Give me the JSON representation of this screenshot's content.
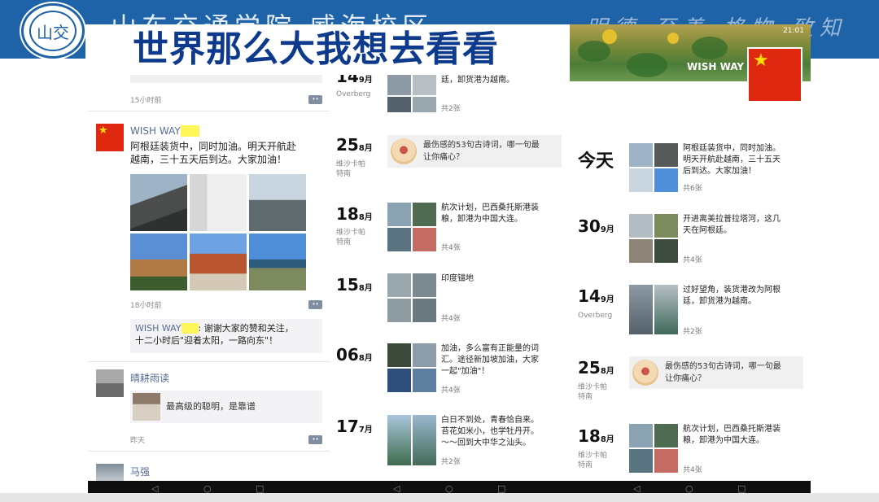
{
  "slide": {
    "title": "世界那么大我想去看看",
    "header_calligraphy_left": "山东交通学院 威海校区",
    "header_calligraphy_right": "明德 至善 格物 致知",
    "logo_text": "山交"
  },
  "colors": {
    "header_blue": "#1e63a8",
    "title_navy": "#0d3a8c",
    "link_blue": "#576b95",
    "flag_red": "#de2910"
  },
  "phone1": {
    "post0_time": "15小时前",
    "post1": {
      "user": "WISH WAY",
      "text_line1": "阿根廷装货中，同时加油。明天开航赴",
      "text_line2": "越南，三十五天后到达。大家加油！",
      "time": "18小时前",
      "comment_user": "WISH WAY",
      "comment_sep": ": ",
      "comment_line1": "谢谢大家的赞和关注，",
      "comment_line2": "十二小时后\"迎着太阳，一路向东\"！"
    },
    "post2": {
      "user": "晴耕雨读",
      "share_text": "最高级的聪明，是靠谱",
      "time": "昨天"
    },
    "post3": {
      "user": "马强"
    }
  },
  "phone2": {
    "entries": [
      {
        "day": "14",
        "month": "9月",
        "loc": "Overberg",
        "text": [
          "廷，卸货港为越南。"
        ],
        "count": "共2张"
      },
      {
        "day": "25",
        "month": "8月",
        "loc": "维沙卡帕\n特南",
        "share": [
          "最伤感的53句古诗词，哪一句最",
          "让你痛心？"
        ]
      },
      {
        "day": "18",
        "month": "8月",
        "loc": "维沙卡帕\n特南",
        "text": [
          "航次计划，巴西桑托斯港装",
          "粮，卸港为中国大连。"
        ],
        "count": "共4张"
      },
      {
        "day": "15",
        "month": "8月",
        "loc": "",
        "text": [
          "印度锚地"
        ],
        "count": "共4张"
      },
      {
        "day": "06",
        "month": "8月",
        "loc": "",
        "text": [
          "加油，多么富有正能量的词",
          "汇。途径新加坡加油，大家",
          "一起\"加油\"！"
        ],
        "count": "共4张"
      },
      {
        "day": "17",
        "month": "7月",
        "loc": "",
        "text": [
          "白日不到处，青春恰自来。",
          "苔花如米小，也学牡丹开。",
          "～～回到大中华之汕头。"
        ],
        "count": "共2张"
      }
    ]
  },
  "phone3": {
    "status": "21:01",
    "profile_name": "WISH WAY",
    "today_label": "今天",
    "entries": [
      {
        "text": [
          "阿根廷装货中，同时加油。",
          "明天开航赴越南，三十五天",
          "后到达。大家加油！"
        ],
        "count": "共6张"
      },
      {
        "day": "30",
        "month": "9月",
        "loc": "",
        "text": [
          "开进离美拉普拉塔河，这几",
          "天在阿根廷。"
        ],
        "count": "共4张"
      },
      {
        "day": "14",
        "month": "9月",
        "loc": "Overberg",
        "text": [
          "过好望角，装货港改为阿根",
          "廷，卸货港为越南。"
        ],
        "count": "共2张"
      },
      {
        "day": "25",
        "month": "8月",
        "loc": "维沙卡帕\n特南",
        "share": [
          "最伤感的53句古诗词，哪一句最",
          "让你痛心？"
        ]
      },
      {
        "day": "18",
        "month": "8月",
        "loc": "维沙卡帕\n特南",
        "text": [
          "航次计划，巴西桑托斯港装",
          "粮，卸港为中国大连。"
        ],
        "count": "共4张"
      }
    ]
  }
}
